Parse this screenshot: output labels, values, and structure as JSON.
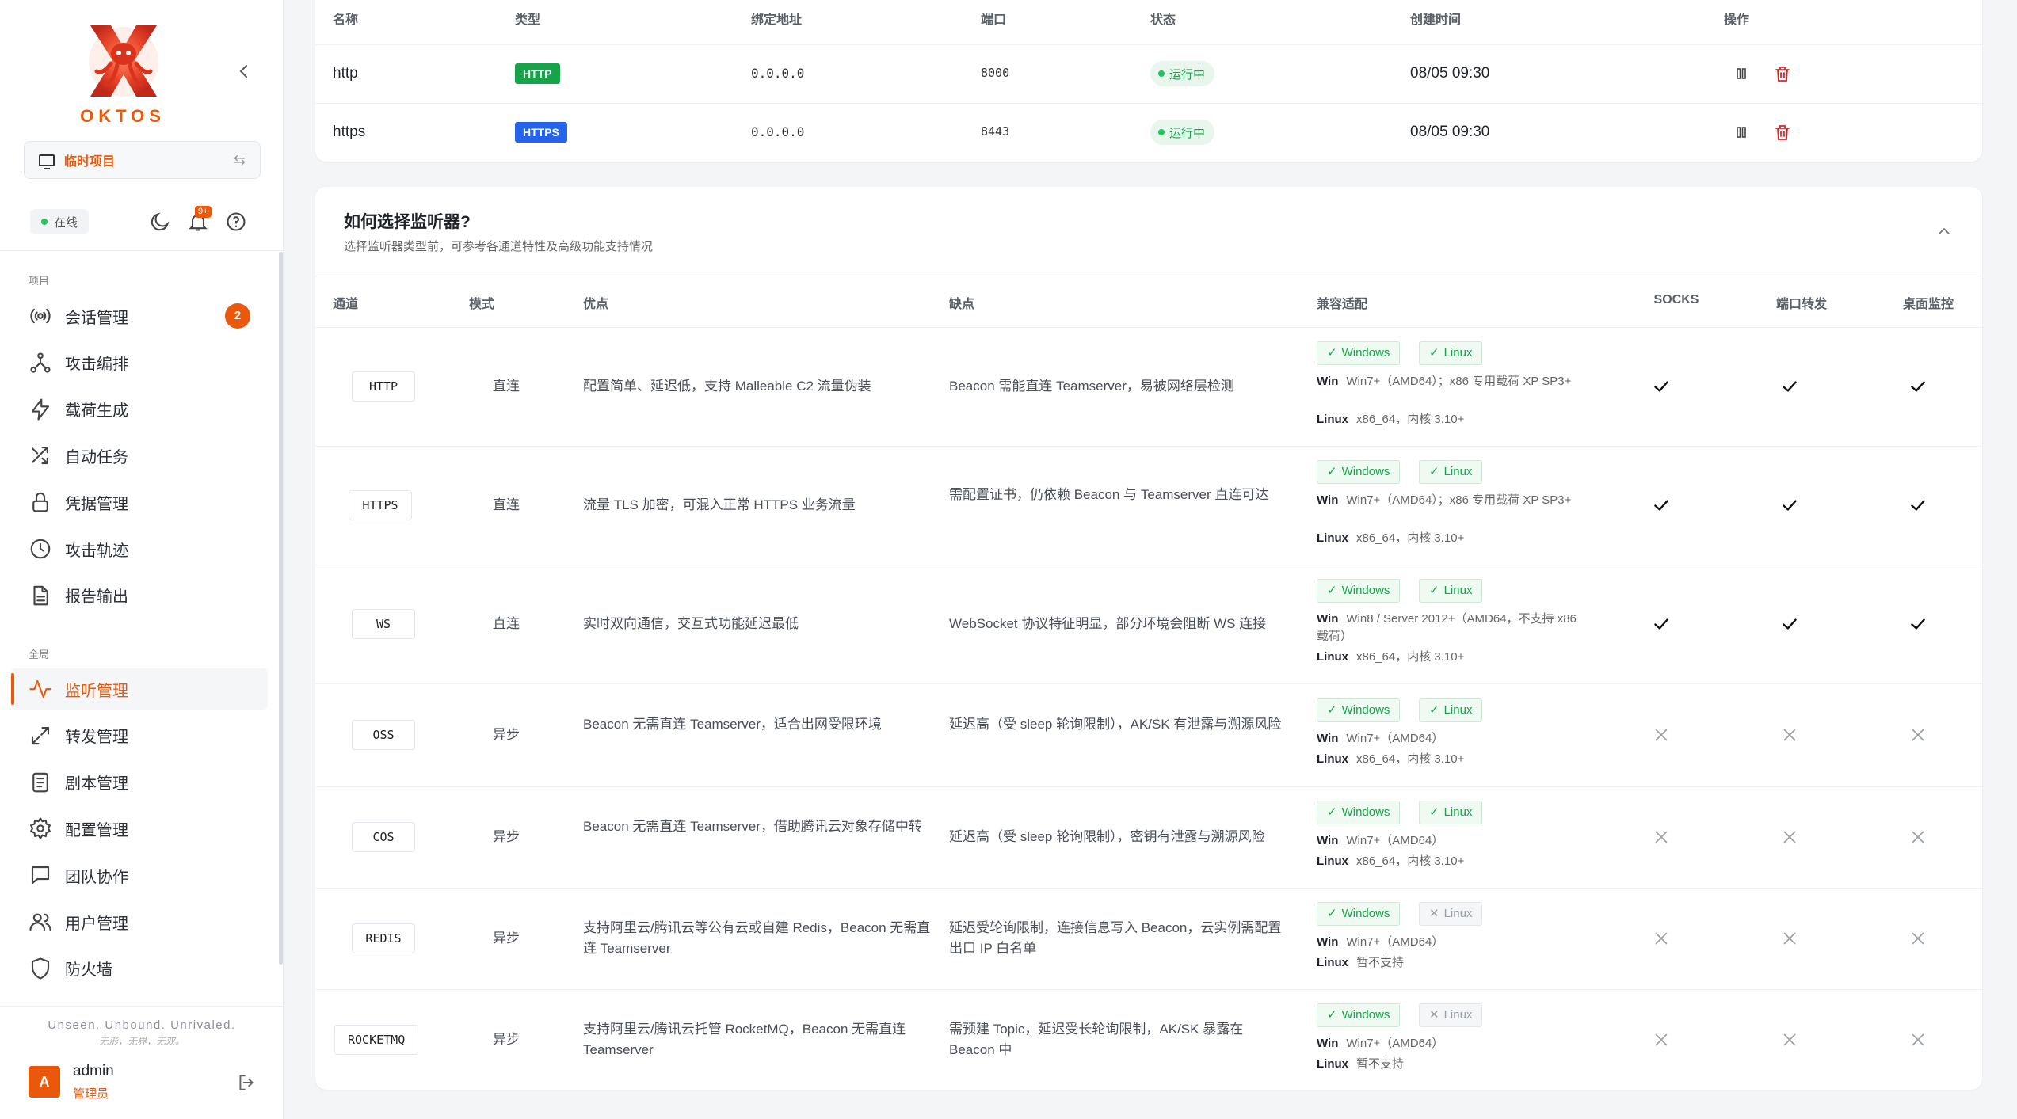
{
  "sidebar": {
    "brand": "OKTOS",
    "project": "临时项目",
    "status": "在线",
    "notif_badge": "9+",
    "section_project": "项目",
    "section_global": "全局",
    "items_project": [
      {
        "label": "会话管理",
        "icon": "broadcast-icon",
        "badge": "2"
      },
      {
        "label": "攻击编排",
        "icon": "graph-icon"
      },
      {
        "label": "载荷生成",
        "icon": "lightning-icon"
      },
      {
        "label": "自动任务",
        "icon": "shuffle-icon"
      },
      {
        "label": "凭据管理",
        "icon": "lock-icon"
      },
      {
        "label": "攻击轨迹",
        "icon": "clock-icon"
      },
      {
        "label": "报告输出",
        "icon": "document-icon"
      }
    ],
    "items_global": [
      {
        "label": "监听管理",
        "icon": "activity-icon",
        "active": true
      },
      {
        "label": "转发管理",
        "icon": "expand-arrows-icon"
      },
      {
        "label": "剧本管理",
        "icon": "playbook-icon"
      },
      {
        "label": "配置管理",
        "icon": "gear-icon"
      },
      {
        "label": "团队协作",
        "icon": "chat-icon"
      },
      {
        "label": "用户管理",
        "icon": "users-icon"
      },
      {
        "label": "防火墙",
        "icon": "shield-icon"
      }
    ],
    "slogan": "Unseen. Unbound. Unrivaled.",
    "slogan_cn": "无形，无界，无双。",
    "user": {
      "initial": "A",
      "name": "admin",
      "role": "管理员"
    }
  },
  "listeners": {
    "headers": [
      "名称",
      "类型",
      "绑定地址",
      "端口",
      "状态",
      "创建时间",
      "操作"
    ],
    "rows": [
      {
        "name": "http",
        "type": "HTTP",
        "address": "0.0.0.0",
        "port": "8000",
        "status": "运行中",
        "created": "08/05 09:30"
      },
      {
        "name": "https",
        "type": "HTTPS",
        "address": "0.0.0.0",
        "port": "8443",
        "status": "运行中",
        "created": "08/05 09:30"
      }
    ]
  },
  "guide": {
    "title": "如何选择监听器?",
    "subtitle": "选择监听器类型前，可参考各通道特性及高级功能支持情况",
    "headers": [
      "通道",
      "模式",
      "优点",
      "缺点",
      "兼容适配",
      "SOCKS",
      "端口转发",
      "桌面监控"
    ],
    "compat_labels": {
      "windows": "Windows",
      "linux": "Linux",
      "win": "Win",
      "lin": "Linux"
    },
    "rows": [
      {
        "channel": "HTTP",
        "mode": "直连",
        "pros": "配置简单、延迟低，支持 Malleable C2 流量伪装",
        "cons": "Beacon 需能直连 Teamserver，易被网络层检测",
        "win_ok": true,
        "linux_ok": true,
        "win_text": "Win7+（AMD64）；x86 专用载荷 XP SP3+",
        "linux_text": "x86_64，内核 3.10+",
        "socks": true,
        "portfwd": true,
        "desktop": true
      },
      {
        "channel": "HTTPS",
        "mode": "直连",
        "pros": "流量 TLS 加密，可混入正常 HTTPS 业务流量",
        "cons": "需配置证书，仍依赖 Beacon 与 Teamserver 直连可达",
        "win_ok": true,
        "linux_ok": true,
        "win_text": "Win7+（AMD64）；x86 专用载荷 XP SP3+",
        "linux_text": "x86_64，内核 3.10+",
        "socks": true,
        "portfwd": true,
        "desktop": true
      },
      {
        "channel": "WS",
        "mode": "直连",
        "pros": "实时双向通信，交互式功能延迟最低",
        "cons": "WebSocket 协议特征明显，部分环境会阻断 WS 连接",
        "win_ok": true,
        "linux_ok": true,
        "win_text": "Win8 / Server 2012+（AMD64，不支持 x86 载荷）",
        "linux_text": "x86_64，内核 3.10+",
        "socks": true,
        "portfwd": true,
        "desktop": true
      },
      {
        "channel": "OSS",
        "mode": "异步",
        "pros": "Beacon 无需直连 Teamserver，适合出网受限环境",
        "cons": "延迟高（受 sleep 轮询限制），AK/SK 有泄露与溯源风险",
        "win_ok": true,
        "linux_ok": true,
        "win_text": "Win7+（AMD64）",
        "linux_text": "x86_64，内核 3.10+",
        "socks": false,
        "portfwd": false,
        "desktop": false
      },
      {
        "channel": "COS",
        "mode": "异步",
        "pros": "Beacon 无需直连 Teamserver，借助腾讯云对象存储中转",
        "cons": "延迟高（受 sleep 轮询限制），密钥有泄露与溯源风险",
        "win_ok": true,
        "linux_ok": true,
        "win_text": "Win7+（AMD64）",
        "linux_text": "x86_64，内核 3.10+",
        "socks": false,
        "portfwd": false,
        "desktop": false
      },
      {
        "channel": "REDIS",
        "mode": "异步",
        "pros": "支持阿里云/腾讯云等公有云或自建 Redis，Beacon 无需直连 Teamserver",
        "cons": "延迟受轮询限制，连接信息写入 Beacon，云实例需配置出口 IP 白名单",
        "win_ok": true,
        "linux_ok": false,
        "win_text": "Win7+（AMD64）",
        "linux_text": "暂不支持",
        "socks": false,
        "portfwd": false,
        "desktop": false
      },
      {
        "channel": "ROCKETMQ",
        "mode": "异步",
        "pros": "支持阿里云/腾讯云托管 RocketMQ，Beacon 无需直连 Teamserver",
        "cons": "需预建 Topic，延迟受长轮询限制，AK/SK 暴露在 Beacon 中",
        "win_ok": true,
        "linux_ok": false,
        "win_text": "Win7+（AMD64）",
        "linux_text": "暂不支持",
        "socks": false,
        "portfwd": false,
        "desktop": false
      }
    ]
  },
  "colors": {
    "accent": "#ea580c",
    "success": "#16a34a",
    "http_tag": "#16a34a",
    "https_tag": "#2563eb",
    "delete": "#dc2626"
  }
}
